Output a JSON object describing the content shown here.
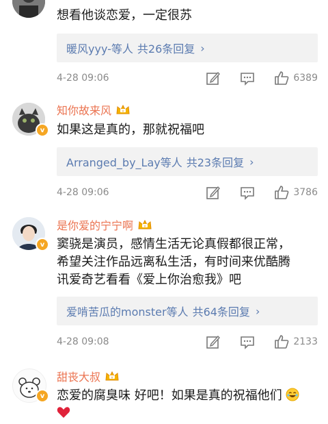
{
  "comments": [
    {
      "username": "",
      "text": "想看他谈恋爱，一定很苏",
      "replies": {
        "who": "暖风yyy-等人",
        "count": "共26条回复"
      },
      "time": "4-28 09:06",
      "likes": "6389"
    },
    {
      "username": "知你故来风",
      "text": "如果这是真的，那就祝福吧",
      "replies": {
        "who": "Arranged_by_Lay等人",
        "count": "共23条回复"
      },
      "time": "4-28 09:06",
      "likes": "3786"
    },
    {
      "username": "是你爱的宁宁啊",
      "text_lines": [
        "窦骁是演员，感情生活无论真假都很正常，",
        "希望关注作品远离私生活，有时间来优酷腾",
        "讯爱奇艺看看《爱上你治愈我》吧"
      ],
      "replies": {
        "who": "爱啃苦瓜的monster等人",
        "count": "共64条回复"
      },
      "time": "4-28 09:08",
      "likes": "2133"
    },
    {
      "username": "甜丧大叔",
      "text": "恋爱的腐臭味 好吧！如果是真的祝福他们"
    }
  ],
  "icons": {
    "edit": "edit-icon",
    "comment": "comment-icon",
    "like": "like-icon",
    "chevron": "chevron-right-icon",
    "crown": "crown-icon",
    "verified": "verified-badge-icon"
  },
  "colors": {
    "username": "#eb7350",
    "link": "#5b7bb0",
    "meta": "#8a8a8a",
    "reply_bg": "#f2f2f2"
  }
}
